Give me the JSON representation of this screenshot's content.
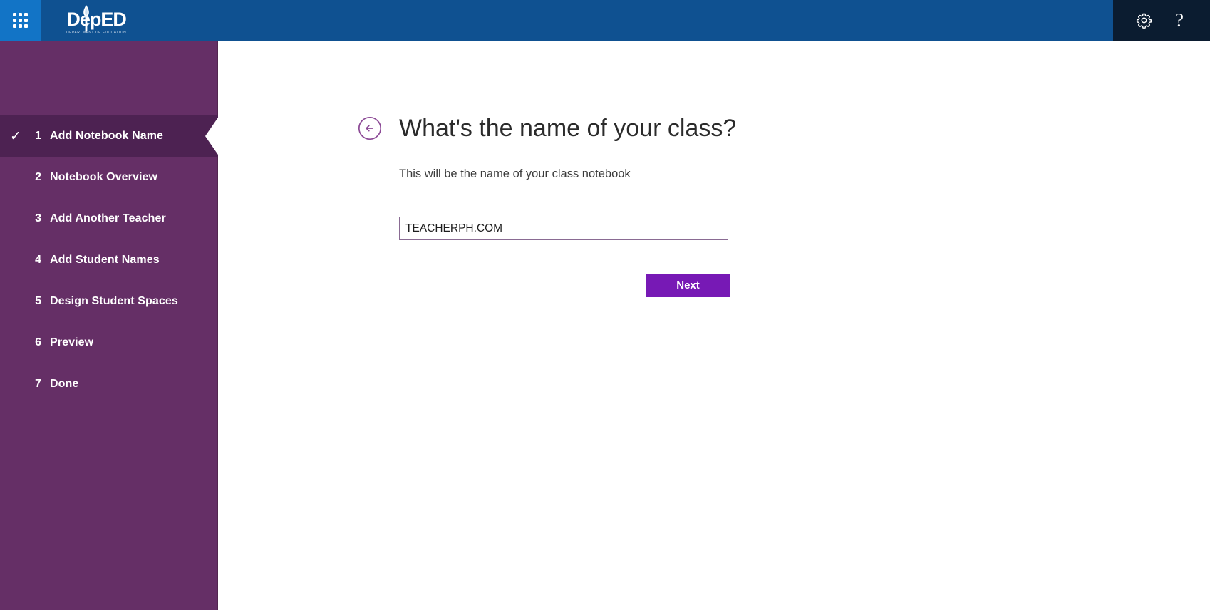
{
  "topbar": {
    "app_launcher_icon": "waffle-grid-icon",
    "brand_name": "DepED",
    "brand_tagline": "DEPARTMENT OF EDUCATION",
    "settings_icon": "gear-icon",
    "help_icon": "question-mark-icon",
    "help_label": "?"
  },
  "sidebar": {
    "steps": [
      {
        "number": "1",
        "label": "Add Notebook Name",
        "active": true,
        "completed": true
      },
      {
        "number": "2",
        "label": "Notebook Overview",
        "active": false,
        "completed": false
      },
      {
        "number": "3",
        "label": "Add Another Teacher",
        "active": false,
        "completed": false
      },
      {
        "number": "4",
        "label": "Add Student Names",
        "active": false,
        "completed": false
      },
      {
        "number": "5",
        "label": "Design Student Spaces",
        "active": false,
        "completed": false
      },
      {
        "number": "6",
        "label": "Preview",
        "active": false,
        "completed": false
      },
      {
        "number": "7",
        "label": "Done",
        "active": false,
        "completed": false
      }
    ],
    "check_glyph": "✓"
  },
  "main": {
    "back_icon": "back-arrow-circle-icon",
    "title": "What's the name of your class?",
    "subtitle": "This will be the name of your class notebook",
    "notebook_name_value": "TEACHERPH.COM",
    "notebook_name_placeholder": "",
    "next_label": "Next"
  },
  "colors": {
    "topbar_blue": "#0f5191",
    "waffle_blue": "#1274c6",
    "topbar_right_dark": "#0b1c30",
    "sidebar_purple": "#652f66",
    "sidebar_active_purple": "#4d2252",
    "accent_purple": "#7719b5",
    "input_border": "#8a6b93"
  }
}
